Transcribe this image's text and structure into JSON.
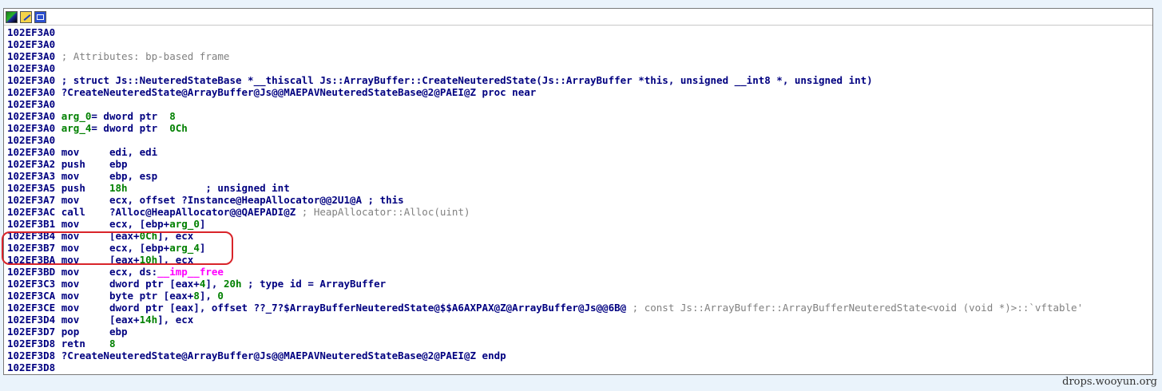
{
  "toolbar": {
    "graph_icon": "graph-view-icon",
    "edit_icon": "edit-icon",
    "hex_icon": "hex-view-icon"
  },
  "lines": [
    {
      "addr": "102EF3A0",
      "parts": []
    },
    {
      "addr": "102EF3A0",
      "parts": []
    },
    {
      "addr": "102EF3A0",
      "parts": [
        {
          "t": " ; Attributes: bp-based frame",
          "c": "cmt"
        }
      ]
    },
    {
      "addr": "102EF3A0",
      "parts": []
    },
    {
      "addr": "102EF3A0",
      "parts": [
        {
          "t": " ; struct Js::NeuteredStateBase *__thiscall Js::ArrayBuffer::CreateNeuteredState(Js::ArrayBuffer *this, unsigned __int8 *, unsigned int)",
          "c": "code"
        }
      ]
    },
    {
      "addr": "102EF3A0",
      "parts": [
        {
          "t": " ?CreateNeuteredState@ArrayBuffer@Js@@MAEPAVNeuteredStateBase@2@PAEI@Z proc near",
          "c": "code"
        }
      ]
    },
    {
      "addr": "102EF3A0",
      "parts": []
    },
    {
      "addr": "102EF3A0",
      "parts": [
        {
          "t": " arg_0",
          "c": "var"
        },
        {
          "t": "= dword ptr  ",
          "c": "code"
        },
        {
          "t": "8",
          "c": "num"
        }
      ]
    },
    {
      "addr": "102EF3A0",
      "parts": [
        {
          "t": " arg_4",
          "c": "var"
        },
        {
          "t": "= dword ptr  ",
          "c": "code"
        },
        {
          "t": "0Ch",
          "c": "num"
        }
      ]
    },
    {
      "addr": "102EF3A0",
      "parts": []
    },
    {
      "addr": "102EF3A0",
      "parts": [
        {
          "t": " mov     edi, edi",
          "c": "code"
        }
      ]
    },
    {
      "addr": "102EF3A2",
      "parts": [
        {
          "t": " push    ebp",
          "c": "code"
        }
      ]
    },
    {
      "addr": "102EF3A3",
      "parts": [
        {
          "t": " mov     ebp, esp",
          "c": "code"
        }
      ]
    },
    {
      "addr": "102EF3A5",
      "parts": [
        {
          "t": " push    ",
          "c": "code"
        },
        {
          "t": "18h",
          "c": "num"
        },
        {
          "t": "             ; unsigned int",
          "c": "code"
        }
      ]
    },
    {
      "addr": "102EF3A7",
      "parts": [
        {
          "t": " mov     ecx, offset ?Instance@HeapAllocator@@2U1@A ; this",
          "c": "code"
        }
      ]
    },
    {
      "addr": "102EF3AC",
      "parts": [
        {
          "t": " call    ?Alloc@HeapAllocator@@QAEPADI@Z",
          "c": "code"
        },
        {
          "t": " ; HeapAllocator::Alloc(uint)",
          "c": "cmt"
        }
      ]
    },
    {
      "addr": "102EF3B1",
      "parts": [
        {
          "t": " mov     ecx, [ebp+",
          "c": "code"
        },
        {
          "t": "arg_0",
          "c": "var"
        },
        {
          "t": "]",
          "c": "code"
        }
      ]
    },
    {
      "addr": "102EF3B4",
      "parts": [
        {
          "t": " mov     [eax+",
          "c": "code"
        },
        {
          "t": "0Ch",
          "c": "num"
        },
        {
          "t": "], ecx",
          "c": "code"
        }
      ]
    },
    {
      "addr": "102EF3B7",
      "parts": [
        {
          "t": " mov     ecx, [ebp+",
          "c": "code"
        },
        {
          "t": "arg_4",
          "c": "var"
        },
        {
          "t": "]",
          "c": "code"
        }
      ]
    },
    {
      "addr": "102EF3BA",
      "parts": [
        {
          "t": " mov     [eax+",
          "c": "code"
        },
        {
          "t": "10h",
          "c": "num"
        },
        {
          "t": "], ecx",
          "c": "code"
        }
      ]
    },
    {
      "addr": "102EF3BD",
      "parts": [
        {
          "t": " mov     ecx, ds:",
          "c": "code"
        },
        {
          "t": "__imp__free",
          "c": "imp"
        }
      ]
    },
    {
      "addr": "102EF3C3",
      "parts": [
        {
          "t": " mov     dword ptr [eax+",
          "c": "code"
        },
        {
          "t": "4",
          "c": "num"
        },
        {
          "t": "], ",
          "c": "code"
        },
        {
          "t": "20h",
          "c": "num"
        },
        {
          "t": " ; type id = ArrayBuffer",
          "c": "code"
        }
      ]
    },
    {
      "addr": "102EF3CA",
      "parts": [
        {
          "t": " mov     byte ptr [eax+",
          "c": "code"
        },
        {
          "t": "8",
          "c": "num"
        },
        {
          "t": "], ",
          "c": "code"
        },
        {
          "t": "0",
          "c": "num"
        }
      ]
    },
    {
      "addr": "102EF3CE",
      "parts": [
        {
          "t": " mov     dword ptr [eax], offset ??_7?$ArrayBufferNeuteredState@$$A6AXPAX@Z@ArrayBuffer@Js@@6B@",
          "c": "code"
        },
        {
          "t": " ; const Js::ArrayBuffer::ArrayBufferNeuteredState<void (void *)>::`vftable'",
          "c": "cmt"
        }
      ]
    },
    {
      "addr": "102EF3D4",
      "parts": [
        {
          "t": " mov     [eax+",
          "c": "code"
        },
        {
          "t": "14h",
          "c": "num"
        },
        {
          "t": "], ecx",
          "c": "code"
        }
      ]
    },
    {
      "addr": "102EF3D7",
      "parts": [
        {
          "t": " pop     ebp",
          "c": "code"
        }
      ]
    },
    {
      "addr": "102EF3D8",
      "parts": [
        {
          "t": " retn    ",
          "c": "code"
        },
        {
          "t": "8",
          "c": "num"
        }
      ]
    },
    {
      "addr": "102EF3D8",
      "parts": [
        {
          "t": " ?CreateNeuteredState@ArrayBuffer@Js@@MAEPAVNeuteredStateBase@2@PAEI@Z endp",
          "c": "code"
        }
      ]
    },
    {
      "addr": "102EF3D8",
      "parts": []
    }
  ],
  "watermark": "drops.wooyun.org"
}
